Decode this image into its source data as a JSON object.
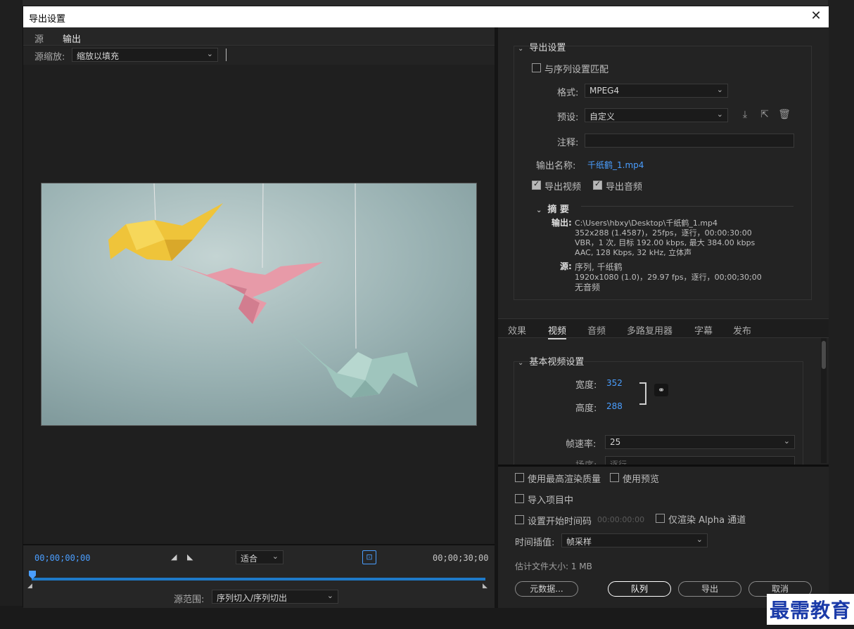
{
  "dialog": {
    "title": "导出设置"
  },
  "left": {
    "tabs": [
      {
        "label": "源"
      },
      {
        "label": "输出"
      }
    ],
    "source_zoom_label": "源缩放:",
    "source_zoom_value": "缩放以填充",
    "timecode_start": "00;00;00;00",
    "timecode_end": "00;00;30;00",
    "fit_value": "适合",
    "source_range_label": "源范围:",
    "source_range_value": "序列切入/序列切出"
  },
  "export_settings": {
    "heading": "导出设置",
    "match_sequence": "与序列设置匹配",
    "format_label": "格式:",
    "format_value": "MPEG4",
    "preset_label": "预设:",
    "preset_value": "自定义",
    "comment_label": "注释:",
    "comment_value": "",
    "output_name_label": "输出名称:",
    "output_name_value": "千纸鹤_1.mp4",
    "export_video": "导出视频",
    "export_audio": "导出音频",
    "summary": {
      "heading": "摘 要",
      "output_label": "输出:",
      "output_lines": [
        "C:\\Users\\hbxy\\Desktop\\千纸鹤_1.mp4",
        "352x288 (1.4587)，25fps，逐行，00:00:30:00",
        "VBR，1 次, 目标 192.00 kbps, 最大 384.00 kbps",
        "AAC, 128 Kbps, 32  kHz, 立体声"
      ],
      "source_label": "源:",
      "source_lines": [
        "序列, 千纸鹤",
        "1920x1080 (1.0)，29.97 fps，逐行，00;00;30;00",
        "无音频"
      ]
    }
  },
  "right_tabs": [
    {
      "label": "效果"
    },
    {
      "label": "视频"
    },
    {
      "label": "音频"
    },
    {
      "label": "多路复用器"
    },
    {
      "label": "字幕"
    },
    {
      "label": "发布"
    }
  ],
  "basic_video": {
    "heading": "基本视频设置",
    "width_label": "宽度:",
    "width_value": "352",
    "height_label": "高度:",
    "height_value": "288",
    "framerate_label": "帧速率:",
    "framerate_value": "25",
    "field_order_label": "场序:",
    "field_order_value": "逐行"
  },
  "bottom": {
    "max_render": "使用最高渲染质量",
    "use_preview": "使用预览",
    "import_project": "导入项目中",
    "set_start_tc": "设置开始时间码",
    "start_tc_value": "00:00:00:00",
    "alpha_only": "仅渲染 Alpha 通道",
    "time_interp_label": "时间插值:",
    "time_interp_value": "帧采样",
    "est_size": "估计文件大小: 1 MB",
    "metadata_btn": "元数据...",
    "queue_btn": "队列",
    "export_btn": "导出",
    "cancel_btn": "取消"
  },
  "watermark": "最需教育",
  "colors": {
    "accent_blue": "#4a9eff",
    "timeline_bar": "#1e7ac9",
    "panel": "#232323"
  }
}
